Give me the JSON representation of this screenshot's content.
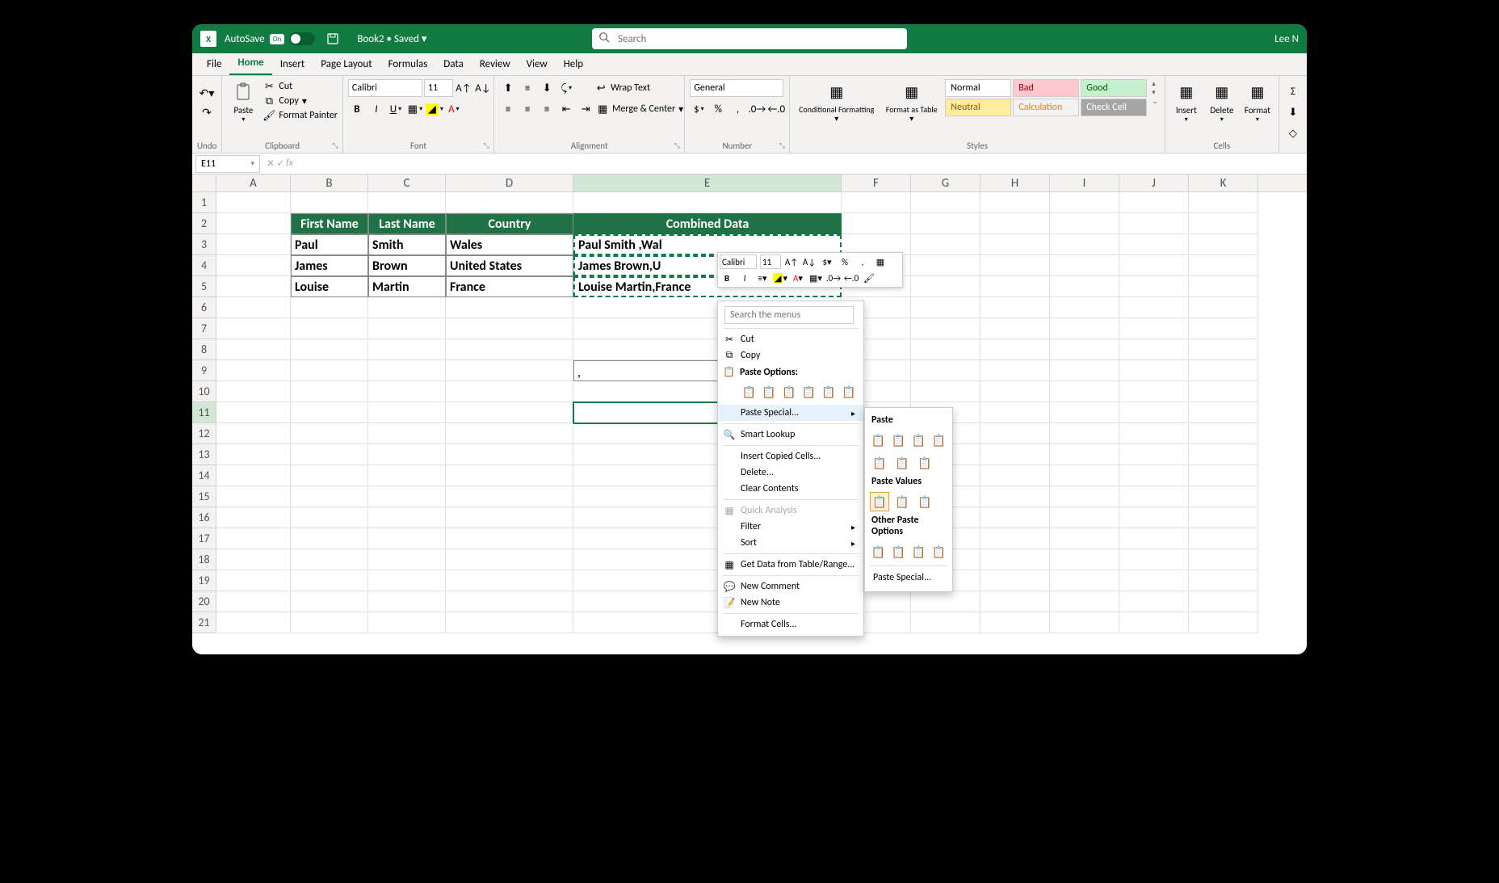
{
  "titlebar": {
    "app_icon": "X",
    "autosave_label": "AutoSave",
    "autosave_state": "On",
    "doc_title": "Book2 • Saved ▾",
    "search_placeholder": "Search",
    "user": "Lee N"
  },
  "menubar": {
    "tabs": [
      "File",
      "Home",
      "Insert",
      "Page Layout",
      "Formulas",
      "Data",
      "Review",
      "View",
      "Help"
    ],
    "active": "Home"
  },
  "ribbon": {
    "undo": "Undo",
    "clipboard": {
      "title": "Clipboard",
      "paste": "Paste",
      "cut": "Cut",
      "copy": "Copy",
      "format_painter": "Format Painter"
    },
    "font": {
      "title": "Font",
      "name": "Calibri",
      "size": "11"
    },
    "alignment": {
      "title": "Alignment",
      "wrap": "Wrap Text",
      "merge": "Merge & Center"
    },
    "number": {
      "title": "Number",
      "format": "General"
    },
    "styles": {
      "title": "Styles",
      "cond_fmt": "Conditional Formatting ▾",
      "fmt_table": "Format as Table ▾",
      "cells": {
        "normal": "Normal",
        "bad": "Bad",
        "good": "Good",
        "neutral": "Neutral",
        "calc": "Calculation",
        "check": "Check Cell"
      }
    },
    "cells": {
      "title": "Cells",
      "insert": "Insert",
      "delete": "Delete",
      "format": "Format"
    }
  },
  "fxbar": {
    "namebox": "E11",
    "formula": ""
  },
  "columns": [
    "A",
    "B",
    "C",
    "D",
    "E",
    "F",
    "G",
    "H",
    "I",
    "J",
    "K"
  ],
  "table": {
    "headers": [
      "First Name",
      "Last Name",
      "Country",
      "Combined Data"
    ],
    "rows": [
      [
        "Paul",
        "Smith",
        "Wales",
        "Paul Smith ,Wal"
      ],
      [
        "James",
        "Brown",
        "United States",
        "James Brown,U"
      ],
      [
        "Louise",
        "Martin",
        "France",
        "Louise Martin,France"
      ]
    ],
    "e9": ","
  },
  "minibar": {
    "font": "Calibri",
    "size": "11"
  },
  "context_menu": {
    "search_placeholder": "Search the menus",
    "cut": "Cut",
    "copy": "Copy",
    "paste_options": "Paste Options:",
    "paste_special": "Paste Special...",
    "smart_lookup": "Smart Lookup",
    "insert_copied": "Insert Copied Cells...",
    "delete": "Delete...",
    "clear_contents": "Clear Contents",
    "quick_analysis": "Quick Analysis",
    "filter": "Filter",
    "sort": "Sort",
    "get_data": "Get Data from Table/Range...",
    "new_comment": "New Comment",
    "new_note": "New Note",
    "format_cells": "Format Cells..."
  },
  "paste_submenu": {
    "paste": "Paste",
    "paste_values": "Paste Values",
    "other": "Other Paste Options",
    "paste_special": "Paste Special..."
  }
}
